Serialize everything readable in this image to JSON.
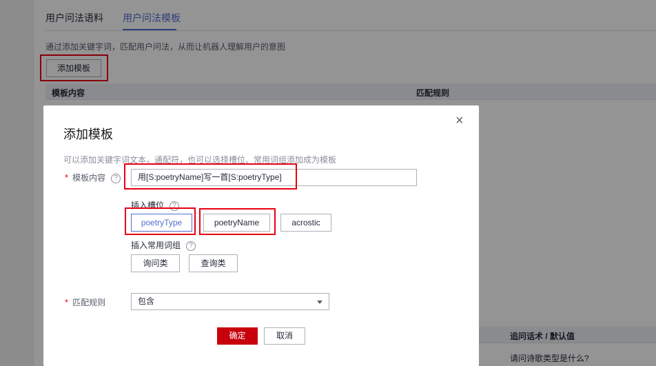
{
  "tabs": [
    {
      "label": "用户问法语料"
    },
    {
      "label": "用户问法模板"
    }
  ],
  "page": {
    "description": "通过添加关键字词，匹配用户问法，从而让机器人理解用户的意图",
    "add_button": "添加模板",
    "columns": [
      "模板内容",
      "匹配规则"
    ],
    "lower_column": "追问话术 / 默认值",
    "lower_cell": "请问诗歌类型是什么?"
  },
  "dialog": {
    "title": "添加模板",
    "close_glyph": "×",
    "description": "可以添加关键字词文本，通配符，也可以选择槽位、常用词组添加成为模板",
    "required_mark": "*",
    "content_label": "模板内容",
    "help_glyph": "?",
    "content_value": "用[S:poetryName]写一首[S:poetryType]",
    "slot_label": "插入槽位",
    "slots": [
      "poetryType",
      "poetryName",
      "acrostic"
    ],
    "words_label": "插入常用词组",
    "words": [
      "询问类",
      "查询类"
    ],
    "match_label": "匹配规则",
    "match_value": "包含",
    "ok": "确定",
    "cancel": "取消"
  },
  "colors": {
    "accent": "#526ecc",
    "primary_button": "#c7000b",
    "highlight": "#e60012"
  }
}
